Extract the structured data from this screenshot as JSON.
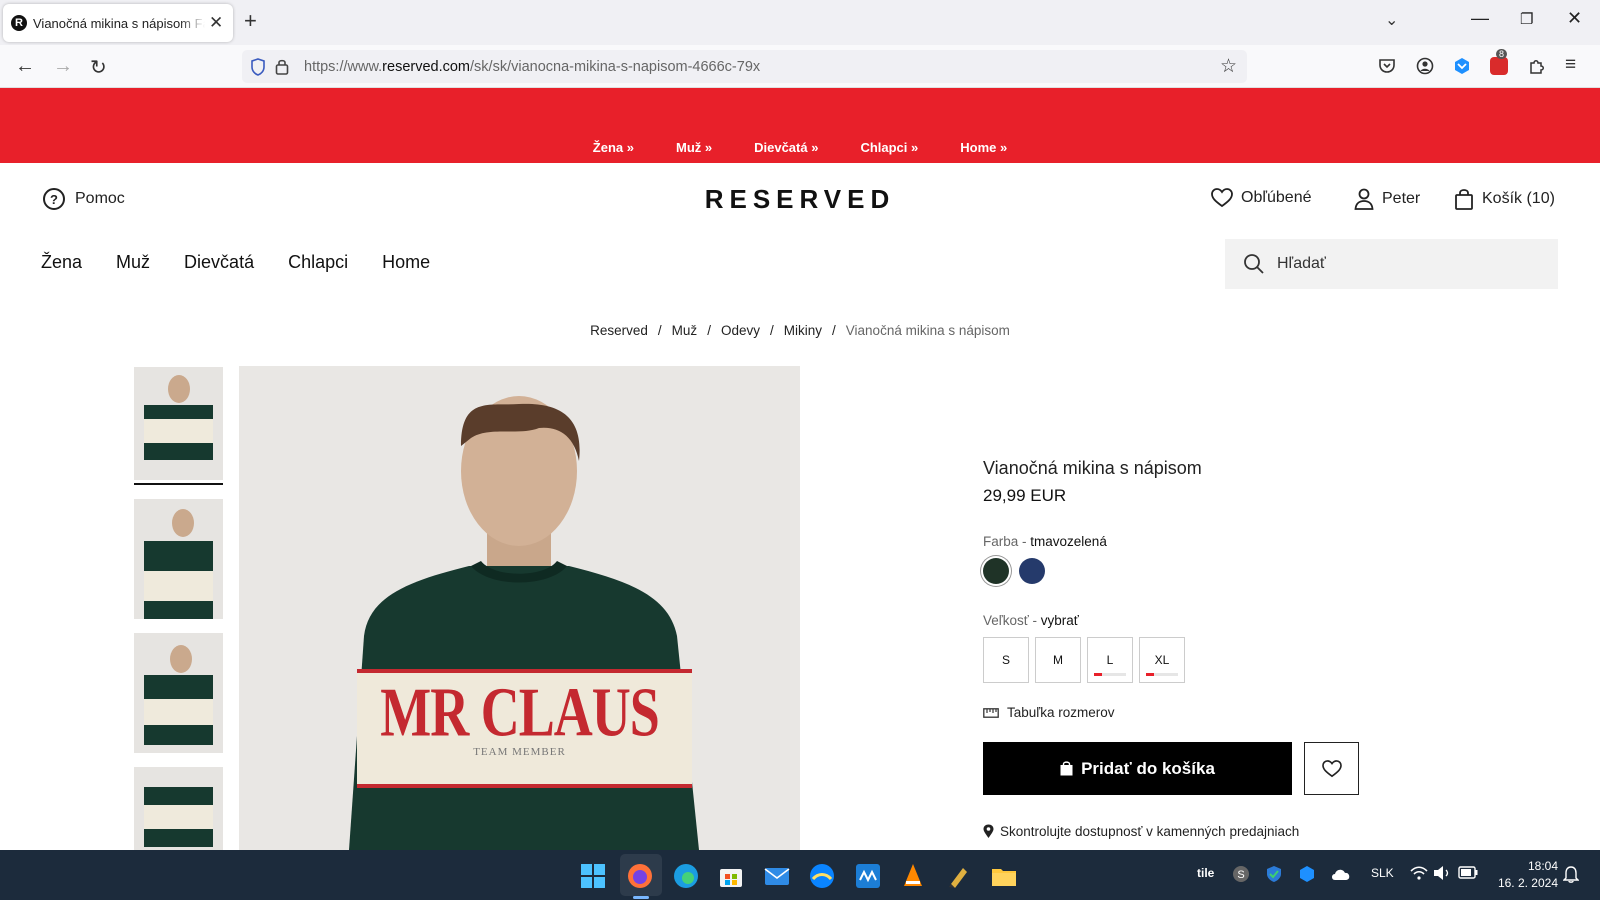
{
  "browser": {
    "tab_title": "Vianočná mikina s nápisom Farba",
    "tab_favicon": "R",
    "url_prefix": "https://www.",
    "url_domain": "reserved.com",
    "url_path": "/sk/sk/vianocna-mikina-s-napisom-4666c-79x",
    "ext_badge": "8"
  },
  "promo": {
    "links": [
      "Žena »",
      "Muž »",
      "Dievčatá »",
      "Chlapci »",
      "Home »"
    ]
  },
  "header": {
    "help": "Pomoc",
    "logo": "RESERVED",
    "favorites": "Obľúbené",
    "user": "Peter",
    "cart": "Košík (10)"
  },
  "nav": [
    "Žena",
    "Muž",
    "Dievčatá",
    "Chlapci",
    "Home"
  ],
  "search": {
    "placeholder": "Hľadať"
  },
  "breadcrumb": [
    "Reserved",
    "Muž",
    "Odevy",
    "Mikiny",
    "Vianočná mikina s nápisom"
  ],
  "hero": {
    "print_main": "MR CLAUS",
    "print_sub": "TEAM MEMBER"
  },
  "product": {
    "name": "Vianočná mikina s nápisom",
    "price": "29,99 EUR",
    "color_label": "Farba -",
    "color_value": "tmavozelená",
    "colors": [
      "#1f3327",
      "#253a6b"
    ],
    "size_label": "Veľkosť -",
    "size_value": "vybrať",
    "sizes": [
      "S",
      "M",
      "L",
      "XL"
    ],
    "low_stock_sizes": [
      "L",
      "XL"
    ],
    "size_chart": "Tabuľka rozmerov",
    "add_to_cart": "Pridať do košíka",
    "store_check": "Skontrolujte dostupnosť v kamenných predajniach"
  },
  "taskbar": {
    "tray_label": "tile",
    "language": "SLK",
    "time": "18:04",
    "date": "16. 2. 2024"
  },
  "colors": {
    "promo_red": "#e8202a",
    "button_black": "#000000"
  }
}
